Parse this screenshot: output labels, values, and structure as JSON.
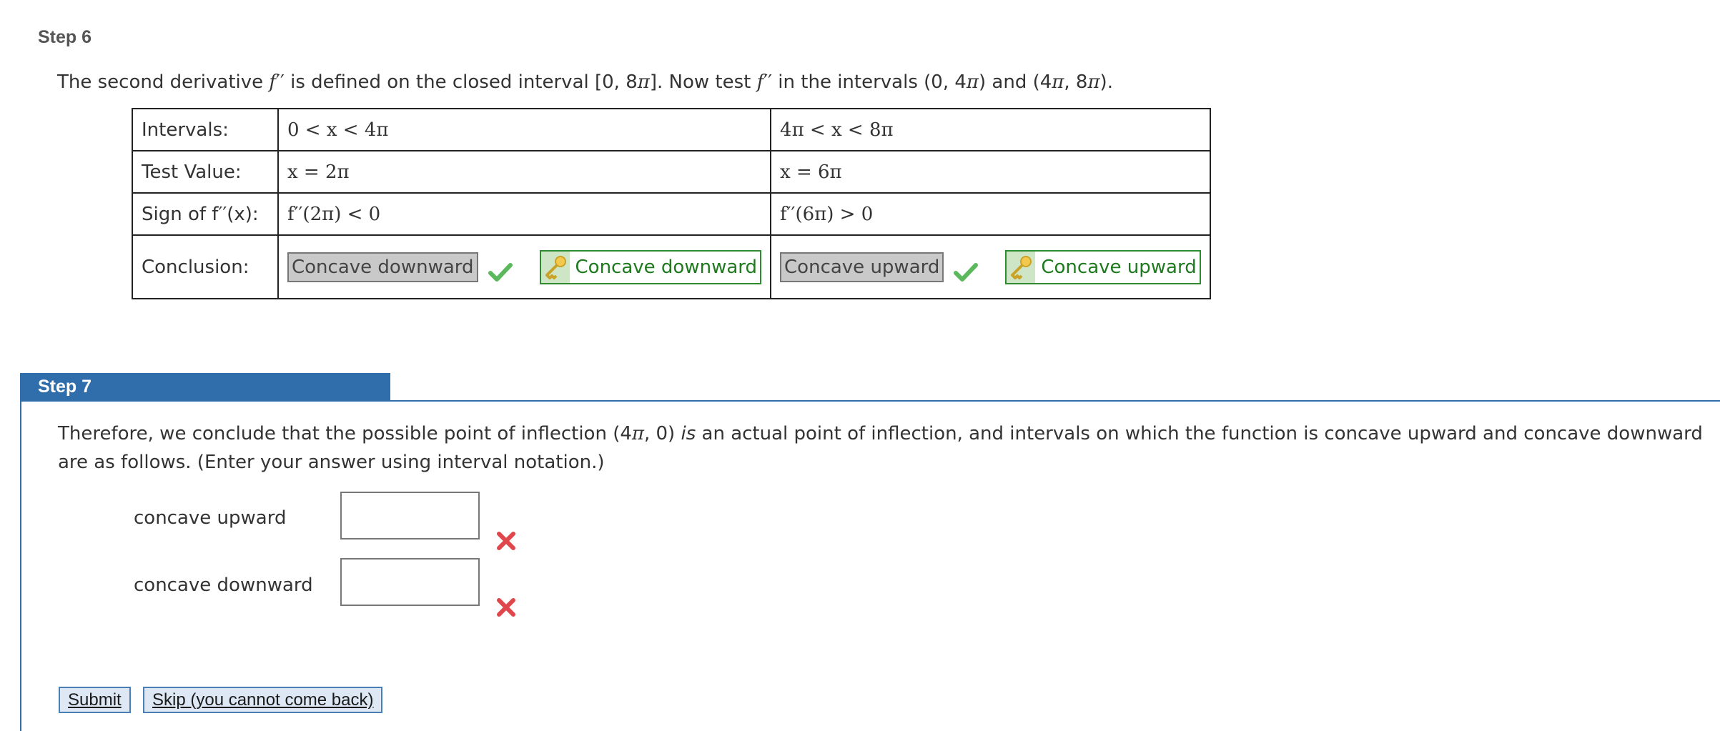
{
  "step6": {
    "title": "Step 6",
    "intro": {
      "t1": "The second derivative ",
      "f": "f",
      "pp": "′′",
      "t2": " is defined on the closed interval [0, 8",
      "pi": "π",
      "t3": "]. Now test ",
      "t4": " in the intervals (0, 4",
      "t5": ") and (4",
      "t6": ", 8",
      "t7": ")."
    },
    "table": {
      "rows": [
        {
          "label": "Intervals:",
          "c1": "0 < x < 4π",
          "c2": "4π < x < 8π"
        },
        {
          "label": "Test Value:",
          "c1": "x = 2π",
          "c2": "x = 6π"
        },
        {
          "label": "Sign of f′′(x):",
          "c1": "f′′(2π) < 0",
          "c2": "f′′(6π) > 0"
        }
      ],
      "conclusion": {
        "label": "Conclusion:",
        "left": {
          "entered": "Concave downward",
          "key": "Concave downward"
        },
        "right": {
          "entered": "Concave upward",
          "key": "Concave upward"
        }
      }
    }
  },
  "step7": {
    "title": "Step 7",
    "para": {
      "t1": "Therefore, we conclude that the possible point of inflection (4",
      "pi": "π",
      "t2": ", 0) ",
      "is": "is",
      "t3": " an actual point of inflection, and intervals on which the function is concave upward and concave downward are as follows. (Enter your answer using interval notation.)"
    },
    "fields": {
      "upward": {
        "label": "concave upward",
        "value": ""
      },
      "downward": {
        "label": "concave downward",
        "value": ""
      }
    },
    "buttons": {
      "submit": "Submit",
      "skip": "Skip (you cannot come back)"
    }
  },
  "colors": {
    "accent": "#2f6eab",
    "correct": "#2e8b2e",
    "incorrect": "#e0474c",
    "check": "#5cb85c"
  },
  "icons": {
    "correct": "check-icon",
    "incorrect": "x-mark-icon",
    "answer_key": "key-icon"
  }
}
